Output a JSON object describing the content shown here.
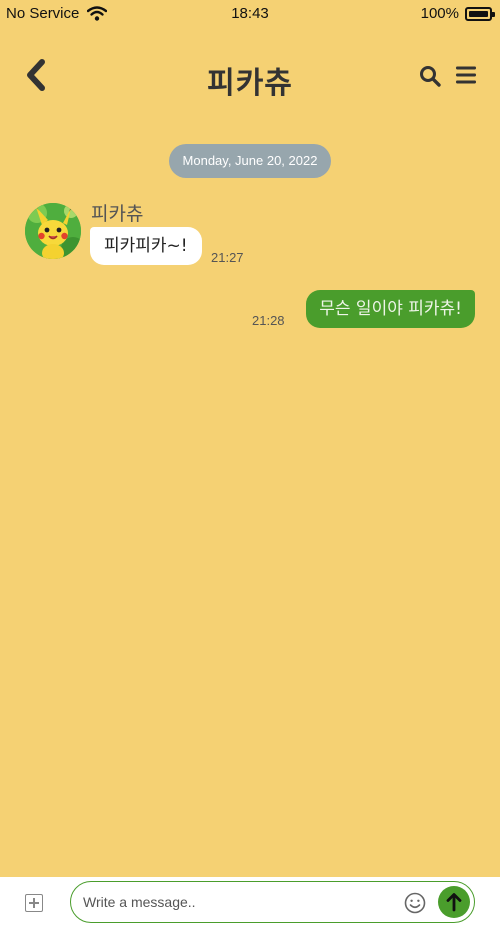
{
  "status_bar": {
    "carrier": "No Service",
    "time": "18:43",
    "battery": "100%",
    "icons": [
      "wifi-icon",
      "battery-icon"
    ]
  },
  "header": {
    "title": "피카츄",
    "icons": [
      "back-chevron-icon",
      "search-icon",
      "hamburger-menu-icon"
    ]
  },
  "chat": {
    "date_label": "Monday, June 20, 2022",
    "messages": [
      {
        "direction": "in",
        "sender": "피카츄",
        "text": "피카피카~!",
        "time": "21:27"
      },
      {
        "direction": "out",
        "text": "무슨 일이야 피카츄!",
        "time": "21:28"
      }
    ]
  },
  "composer": {
    "placeholder": "Write a message..",
    "value": "",
    "icons": [
      "add-attachment-icon",
      "emoji-icon",
      "send-arrow-icon"
    ]
  },
  "colors": {
    "background": "#f5d173",
    "accent_green": "#4a9d2c",
    "date_pill": "#97a6ad",
    "incoming_bubble": "#ffffff"
  }
}
